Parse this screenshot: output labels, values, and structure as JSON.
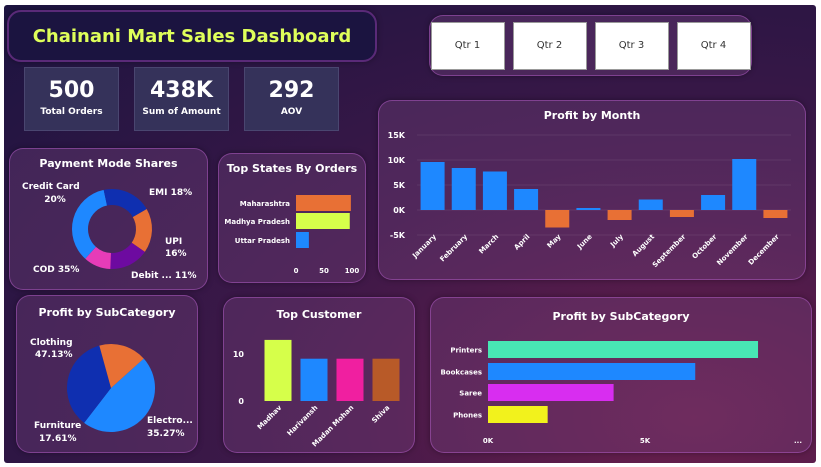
{
  "header": {
    "title": "Chainani Mart Sales Dashboard"
  },
  "quarters": [
    "Qtr 1",
    "Qtr 2",
    "Qtr 3",
    "Qtr 4"
  ],
  "kpis": [
    {
      "value": "500",
      "label": "Total Orders"
    },
    {
      "value": "438K",
      "label": "Sum of Amount"
    },
    {
      "value": "292",
      "label": "AOV"
    }
  ],
  "colors": {
    "blue": "#1e88ff",
    "orange": "#e87035",
    "lime": "#d6ff4a",
    "teal": "#48e6b4",
    "magenta": "#d82df0",
    "yellow": "#f2f21c",
    "navy": "#0f2fb0",
    "purple": "#6d0aa0",
    "pink": "#e63cb8",
    "hotpink": "#f01fa0",
    "brown": "#b85a28"
  },
  "chart_data": [
    {
      "type": "bar",
      "title": "Profit by Month",
      "categories": [
        "January",
        "February",
        "March",
        "April",
        "May",
        "June",
        "July",
        "August",
        "September",
        "October",
        "November",
        "December"
      ],
      "values": [
        9600,
        8400,
        7700,
        4200,
        -3500,
        400,
        -2000,
        2100,
        -1400,
        3000,
        10200,
        -1600
      ],
      "yticks": [
        "15K",
        "10K",
        "5K",
        "0K",
        "-5K"
      ],
      "ylim": [
        -5000,
        15000
      ]
    },
    {
      "type": "pie",
      "subtype": "donut",
      "title": "Payment Mode Shares",
      "slices": [
        {
          "name": "EMI",
          "value": 18,
          "label": "EMI 18%",
          "color": "#e87035"
        },
        {
          "name": "UPI",
          "value": 16,
          "label": "UPI 16%",
          "color": "#6d0aa0"
        },
        {
          "name": "Debit ...",
          "value": 11,
          "label": "Debit ... 11%",
          "color": "#e63cb8"
        },
        {
          "name": "COD",
          "value": 35,
          "label": "COD 35%",
          "color": "#1e88ff"
        },
        {
          "name": "Credit Card",
          "value": 20,
          "label": "Credit Card 20%",
          "color": "#0f2fb0"
        }
      ]
    },
    {
      "type": "bar",
      "orientation": "horizontal",
      "title": "Top States By Orders",
      "categories": [
        "Maharashtra",
        "Madhya Pradesh",
        "Uttar Pradesh"
      ],
      "values": [
        98,
        96,
        23
      ],
      "colors": [
        "#e87035",
        "#d6ff4a",
        "#1e88ff"
      ],
      "xticks": [
        "0",
        "50",
        "100"
      ],
      "xlim": [
        0,
        100
      ]
    },
    {
      "type": "pie",
      "title": "Profit by SubCategory",
      "slices": [
        {
          "name": "Clothing",
          "value": 47.13,
          "label": "47.13%",
          "color": "#1e88ff"
        },
        {
          "name": "Electro...",
          "value": 35.27,
          "label": "35.27%",
          "color": "#0f2fb0"
        },
        {
          "name": "Furniture",
          "value": 17.61,
          "label": "17.61%",
          "color": "#e87035"
        }
      ]
    },
    {
      "type": "bar",
      "title": "Top Customer",
      "categories": [
        "Madhav",
        "Harivansh",
        "Madan Mohan",
        "Shiva"
      ],
      "values": [
        13,
        9,
        9,
        9
      ],
      "colors": [
        "#d6ff4a",
        "#1e88ff",
        "#f01fa0",
        "#b85a28"
      ],
      "yticks": [
        "10",
        "0"
      ],
      "ylim": [
        0,
        15
      ]
    },
    {
      "type": "bar",
      "orientation": "horizontal",
      "title": "Profit by SubCategory",
      "categories": [
        "Printers",
        "Bookcases",
        "Saree",
        "Phones"
      ],
      "values": [
        8600,
        6600,
        4000,
        1900
      ],
      "colors": [
        "#48e6b4",
        "#1e88ff",
        "#d82df0",
        "#f2f21c"
      ],
      "xticks": [
        "0K",
        "5K",
        "..."
      ],
      "xlim": [
        0,
        10000
      ]
    }
  ]
}
